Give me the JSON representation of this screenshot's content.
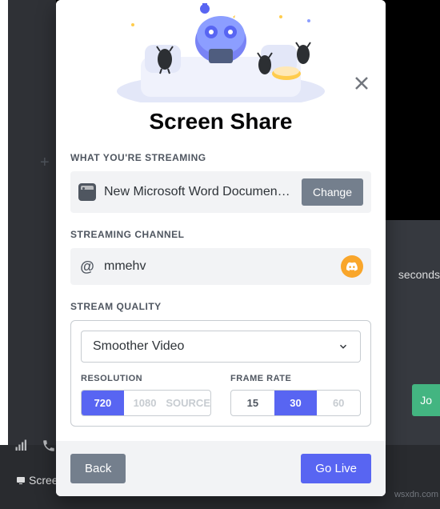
{
  "bg": {
    "plus": "+",
    "seconds_text": "seconds",
    "join": "Jo",
    "screen_label": "Screen"
  },
  "modal": {
    "title": "Screen Share",
    "streaming_section": "WHAT YOU'RE STREAMING",
    "app_name": "New Microsoft Word Document ...",
    "change_btn": "Change",
    "channel_section": "STREAMING CHANNEL",
    "channel_at": "@",
    "channel_name": "mmehv",
    "quality_section": "STREAM QUALITY",
    "quality_select": "Smoother Video",
    "resolution_label": "RESOLUTION",
    "resolutions": [
      "720",
      "1080",
      "SOURCE"
    ],
    "framerate_label": "FRAME RATE",
    "framerates": [
      "15",
      "30",
      "60"
    ],
    "back_btn": "Back",
    "golive_btn": "Go Live"
  },
  "watermark": "wsxdn.com"
}
